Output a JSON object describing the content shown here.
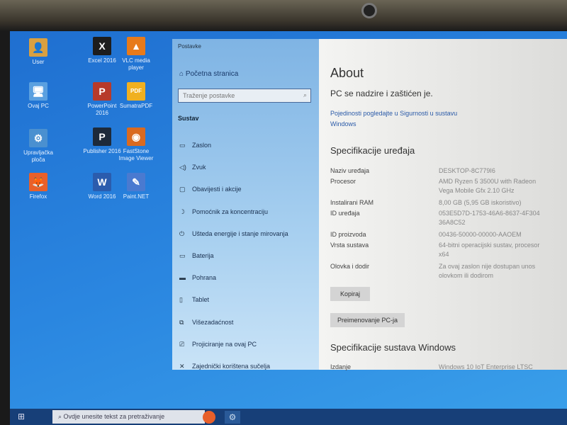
{
  "desktop": {
    "icons": [
      {
        "label": "User",
        "color": "#d9a040",
        "glyph": "👤"
      },
      {
        "label": "Ovaj PC",
        "color": "#5aa0e0",
        "glyph": "🖥"
      },
      {
        "label": "Upravljačka ploča",
        "color": "#4a90d0",
        "glyph": "⚙"
      },
      {
        "label": "Firefox",
        "color": "#e8602a",
        "glyph": "🦊"
      },
      {
        "label": "Excel 2016",
        "color": "#1d1d1d",
        "glyph": "X"
      },
      {
        "label": "PowerPoint 2016",
        "color": "#b73a2a",
        "glyph": "P"
      },
      {
        "label": "Publisher 2016",
        "color": "#1d2a3a",
        "glyph": "P"
      },
      {
        "label": "Word 2016",
        "color": "#2b5cad",
        "glyph": "W"
      },
      {
        "label": "VLC media player",
        "color": "#e77a1a",
        "glyph": "▲"
      },
      {
        "label": "SumatraPDF",
        "color": "#f0b020",
        "glyph": "PDF"
      },
      {
        "label": "FastStone Image Viewer",
        "color": "#d96a20",
        "glyph": "◉"
      },
      {
        "label": "Paint.NET",
        "color": "#4a7ad0",
        "glyph": "✎"
      }
    ]
  },
  "settings": {
    "title": "Postavke",
    "home": "Početna stranica",
    "search_placeholder": "Traženje postavke",
    "section": "Sustav",
    "nav": [
      {
        "label": "Zaslon",
        "icon": "▭"
      },
      {
        "label": "Zvuk",
        "icon": "◁)"
      },
      {
        "label": "Obavijesti i akcije",
        "icon": "▢"
      },
      {
        "label": "Pomoćnik za koncentraciju",
        "icon": "☽"
      },
      {
        "label": "Ušteda energije i stanje mirovanja",
        "icon": "⏻"
      },
      {
        "label": "Baterija",
        "icon": "▭"
      },
      {
        "label": "Pohrana",
        "icon": "▬"
      },
      {
        "label": "Tablet",
        "icon": "▯"
      },
      {
        "label": "Višezadaćnost",
        "icon": "⧉"
      },
      {
        "label": "Projiciranje na ovaj PC",
        "icon": "⎚"
      },
      {
        "label": "Zajednički korištena sučelja",
        "icon": "✕"
      }
    ],
    "about": {
      "title": "About",
      "status": "PC se nadzire i zaštićen je.",
      "link": "Pojedinosti pogledajte u Sigurnosti u sustavu Windows",
      "device_spec_title": "Specifikacije uređaja",
      "specs": [
        {
          "k": "Naziv uređaja",
          "v": "DESKTOP-8C779I6"
        },
        {
          "k": "Procesor",
          "v": "AMD Ryzen 5 3500U with Radeon Vega Mobile Gfx    2.10 GHz"
        },
        {
          "k": "Instalirani RAM",
          "v": "8,00 GB (5,95 GB iskoristivo)"
        },
        {
          "k": "ID uređaja",
          "v": "053E5D7D-1753-46A6-8637-4F304 36A8C52"
        },
        {
          "k": "ID proizvoda",
          "v": "00436-50000-00000-AAOEM"
        },
        {
          "k": "Vrsta sustava",
          "v": "64-bitni operacijski sustav, procesor x64"
        },
        {
          "k": "Olovka i dodir",
          "v": "Za ovaj zaslon nije dostupan unos olovkom ili dodirom"
        }
      ],
      "copy_button": "Kopiraj",
      "rename_button": "Preimenovanje PC-ja",
      "windows_spec_title": "Specifikacije sustava Windows",
      "edition_k": "Izdanje",
      "edition_v": "Windows 10 IoT Enterprise LTSC"
    }
  },
  "taskbar": {
    "search_placeholder": "Ovdje unesite tekst za pretraživanje"
  }
}
